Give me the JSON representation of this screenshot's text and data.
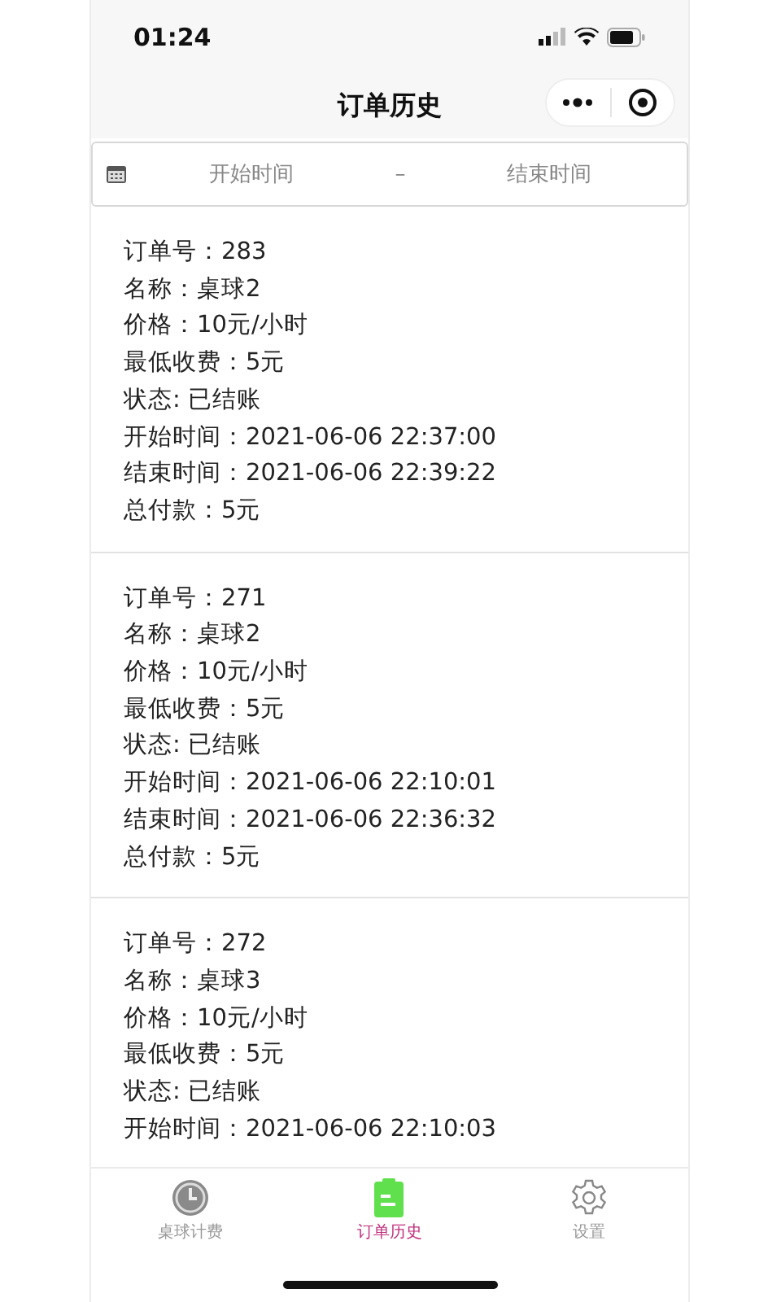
{
  "status_bar": {
    "time": "01:24"
  },
  "nav_bar": {
    "title": "订单历史"
  },
  "date_filter": {
    "start_placeholder": "开始时间",
    "separator": "–",
    "end_placeholder": "结束时间"
  },
  "orders": [
    {
      "lines": [
        "订单号：283",
        "名称：桌球2",
        "价格：10元/小时",
        "最低收费：5元",
        "状态: 已结账",
        "开始时间：2021-06-06 22:37:00",
        "结束时间：2021-06-06 22:39:22",
        "总付款：5元"
      ]
    },
    {
      "lines": [
        "订单号：271",
        "名称：桌球2",
        "价格：10元/小时",
        "最低收费：5元",
        "状态: 已结账",
        "开始时间：2021-06-06 22:10:01",
        "结束时间：2021-06-06 22:36:32",
        "总付款：5元"
      ]
    },
    {
      "lines": [
        "订单号：272",
        "名称：桌球3",
        "价格：10元/小时",
        "最低收费：5元",
        "状态: 已结账",
        "开始时间：2021-06-06 22:10:03"
      ]
    }
  ],
  "tab_bar": [
    {
      "kind": "clock",
      "label": "桌球计费",
      "selected": false
    },
    {
      "kind": "clipboard",
      "label": "订单历史",
      "selected": true
    },
    {
      "kind": "gear",
      "label": "设置",
      "selected": false
    }
  ]
}
